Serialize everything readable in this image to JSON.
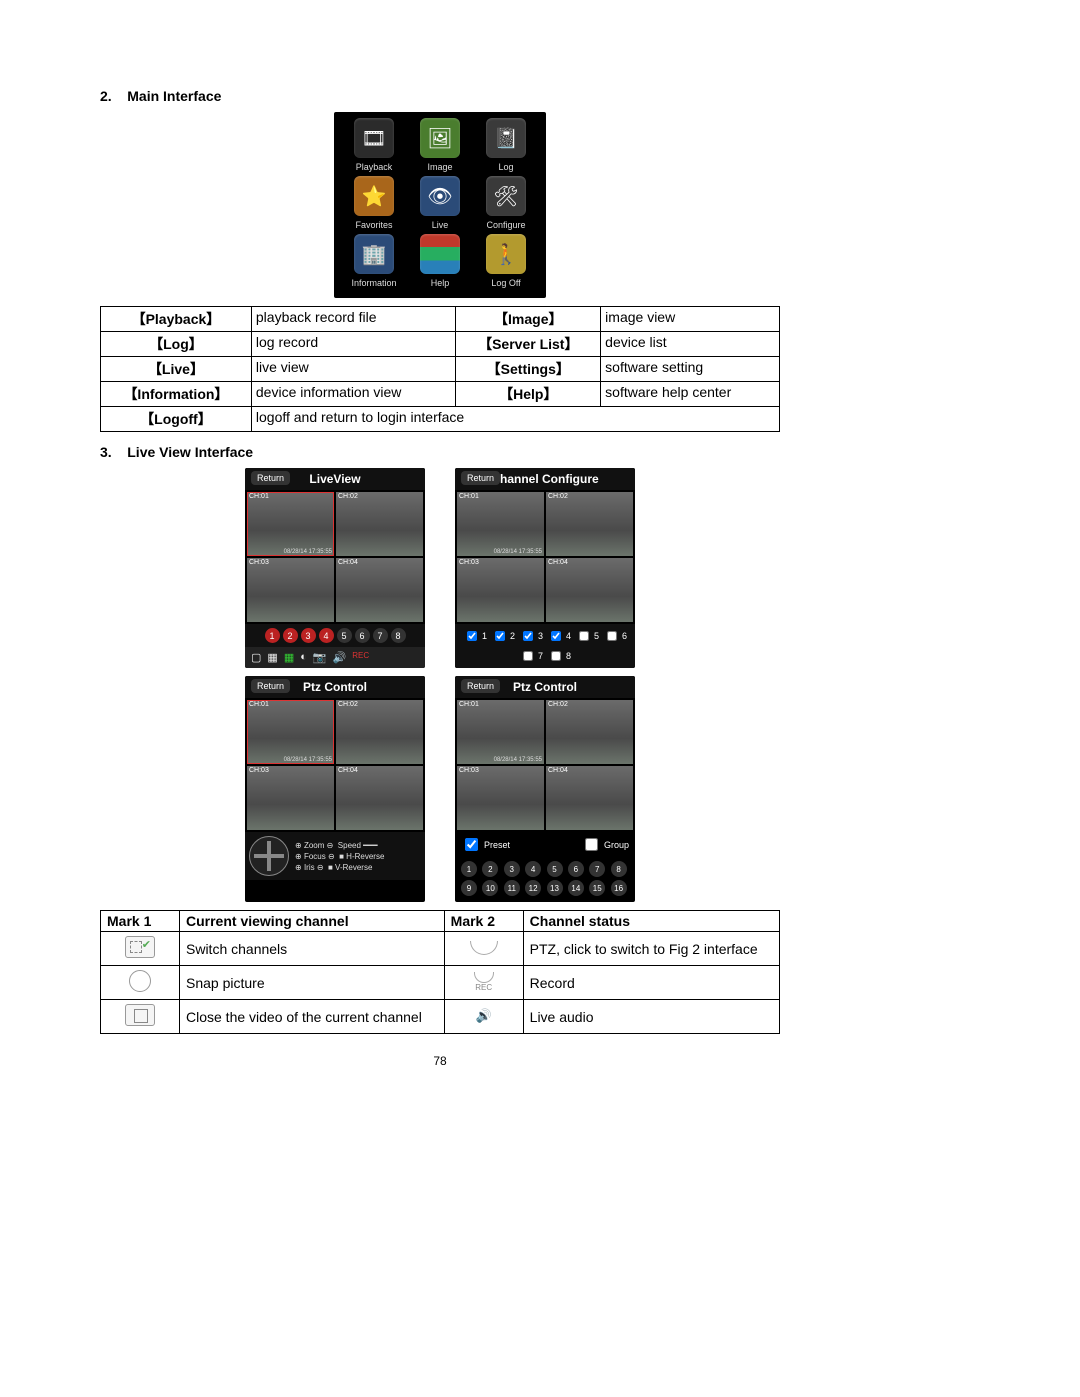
{
  "section2": {
    "number": "2.",
    "title": "Main Interface"
  },
  "apps": [
    {
      "label": "Playback",
      "glyph": "🎞",
      "bg": "bg-dark"
    },
    {
      "label": "Image",
      "glyph": "🖼",
      "bg": "bg-green"
    },
    {
      "label": "Log",
      "glyph": "📓",
      "bg": "bg-grey"
    },
    {
      "label": "Favorites",
      "glyph": "⭐",
      "bg": "bg-orange"
    },
    {
      "label": "Live",
      "glyph": "👁",
      "bg": "bg-blue"
    },
    {
      "label": "Configure",
      "glyph": "🛠",
      "bg": "bg-grey"
    },
    {
      "label": "Information",
      "glyph": "🏢",
      "bg": "bg-blue"
    },
    {
      "label": "Help",
      "glyph": "",
      "bg": "bg-books"
    },
    {
      "label": "Log Off",
      "glyph": "🚶",
      "bg": "bg-yellow"
    }
  ],
  "defs": [
    {
      "k1": "【Playback】",
      "v1": "playback record file",
      "k2": "【Image】",
      "v2": "image view"
    },
    {
      "k1": "【Log】",
      "v1": "log record",
      "k2": "【Server List】",
      "v2": "device list"
    },
    {
      "k1": "【Live】",
      "v1": "live view",
      "k2": "【Settings】",
      "v2": "software setting"
    },
    {
      "k1": "【Information】",
      "v1": "device information view",
      "k2": "【Help】",
      "v2": "software help center"
    }
  ],
  "defs_last": {
    "k": "【Logoff】",
    "v": "logoff and return to login interface"
  },
  "section3": {
    "number": "3.",
    "title": "Live View Interface"
  },
  "ui": {
    "return": "Return",
    "liveview": "LiveView",
    "channel_cfg": "Channel Configure",
    "ptz": "Ptz Control",
    "preset": "Preset",
    "group": "Group",
    "rec": "REC"
  },
  "cam_tag_prefix": "CH:",
  "timestamp": "08/28/14 17:35:55",
  "ptz_labels": {
    "zoom": "Zoom",
    "speed": "Speed",
    "focus": "Focus",
    "hrev": "H-Reverse",
    "iris": "Iris",
    "vrev": "V-Reverse"
  },
  "mark_headers": {
    "m1": "Mark 1",
    "c1": "Current viewing channel",
    "m2": "Mark 2",
    "c2": "Channel status"
  },
  "mark_rows": [
    {
      "d1": "Switch channels",
      "d2": "PTZ, click to switch to Fig 2 interface",
      "i1": "mi-switch",
      "i2": "mi-ptz"
    },
    {
      "d1": "Snap picture",
      "d2": "Record",
      "i1": "mi-snap",
      "i2": "mi-rec"
    },
    {
      "d1": "Close the video of the current channel",
      "d2": "Live audio",
      "i1": "mi-close",
      "i2": "mi-audio"
    }
  ],
  "page": "78"
}
